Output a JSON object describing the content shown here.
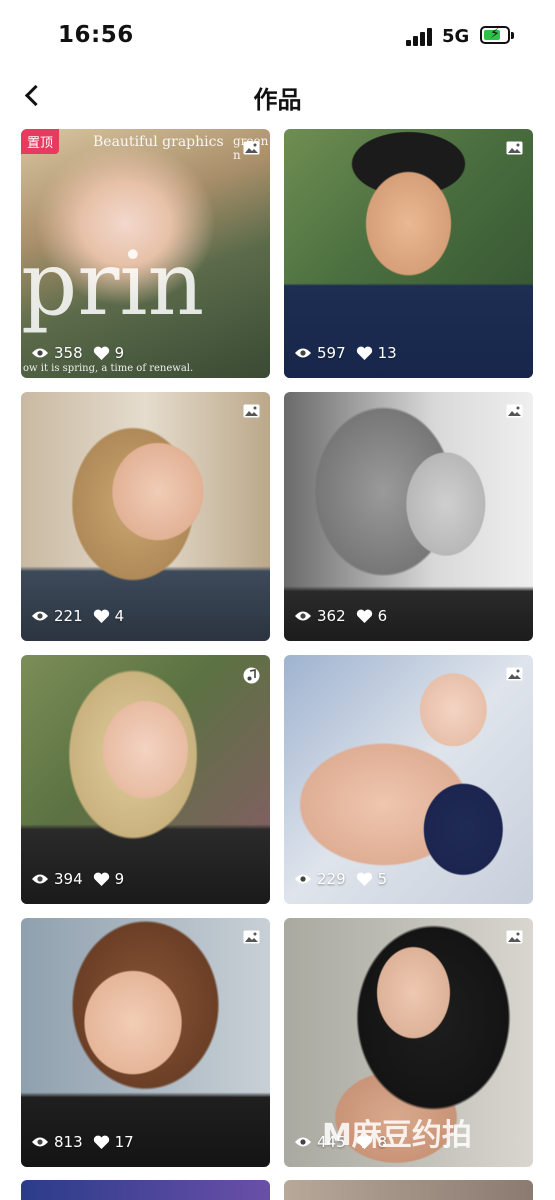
{
  "status_bar": {
    "time": "16:56",
    "network": "5G"
  },
  "nav": {
    "title": "作品"
  },
  "cards": [
    {
      "views": "358",
      "likes": "9",
      "pinned_label": "置顶",
      "type": "image-icon",
      "overlay": {
        "header1": "Beautiful graphics",
        "header2": "green n",
        "big": "prin",
        "caption": "ow it is spring, a time of renewal."
      }
    },
    {
      "views": "597",
      "likes": "13",
      "type": "image-icon"
    },
    {
      "views": "221",
      "likes": "4",
      "type": "image-icon"
    },
    {
      "views": "362",
      "likes": "6",
      "type": "image-icon"
    },
    {
      "views": "394",
      "likes": "9",
      "type": "music-icon"
    },
    {
      "views": "229",
      "likes": "5",
      "type": "image-icon"
    },
    {
      "views": "813",
      "likes": "17",
      "type": "image-icon"
    },
    {
      "views": "445",
      "likes": "8",
      "type": "image-icon"
    }
  ],
  "watermark": "M麻豆约拍",
  "colors": {
    "accent": "#e8395f",
    "stat_text": "#ffffff"
  }
}
